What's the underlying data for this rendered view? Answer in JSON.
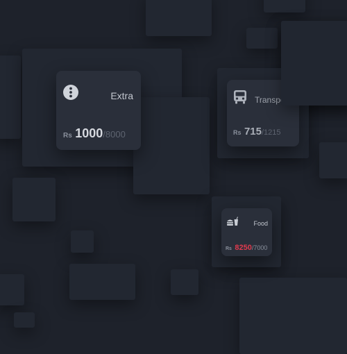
{
  "colors": {
    "background": "#1e222b",
    "card": "#2a2f3a",
    "text_primary": "#d6d9df",
    "text_muted": "#5e6470",
    "over_budget": "#e03a4e"
  },
  "cards": [
    {
      "title": "Extra",
      "icon": "more-vertical-icon",
      "currency": "Rs",
      "spent": "1000",
      "budget": "/8000",
      "over_budget": false
    },
    {
      "title": "Transport",
      "icon": "bus-icon",
      "currency": "Rs",
      "spent": "715",
      "budget": "/1215",
      "over_budget": false
    },
    {
      "title": "Food",
      "icon": "fast-food-icon",
      "currency": "Rs",
      "spent": "8250",
      "budget": "/7000",
      "over_budget": true
    }
  ]
}
